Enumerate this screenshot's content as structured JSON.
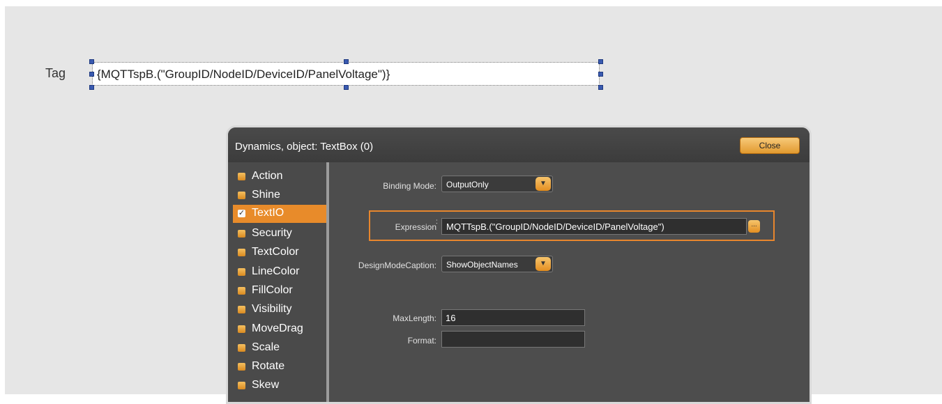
{
  "canvas": {
    "tag_label": "Tag",
    "tag_value": "{MQTTspB.(\"GroupID/NodeID/DeviceID/PanelVoltage\")}"
  },
  "dialog": {
    "title": "Dynamics, object: TextBox (0)",
    "close_label": "Close",
    "sidebar": [
      {
        "label": "Action",
        "selected": false
      },
      {
        "label": "Shine",
        "selected": false
      },
      {
        "label": "TextIO",
        "selected": true
      },
      {
        "label": "Security",
        "selected": false
      },
      {
        "label": "TextColor",
        "selected": false
      },
      {
        "label": "LineColor",
        "selected": false
      },
      {
        "label": "FillColor",
        "selected": false
      },
      {
        "label": "Visibility",
        "selected": false
      },
      {
        "label": "MoveDrag",
        "selected": false
      },
      {
        "label": "Scale",
        "selected": false
      },
      {
        "label": "Rotate",
        "selected": false
      },
      {
        "label": "Skew",
        "selected": false
      }
    ],
    "fields": {
      "binding_mode": {
        "label": "Binding Mode:",
        "value": "OutputOnly"
      },
      "expression": {
        "label": "Expression",
        "colon": ":",
        "value": "MQTTspB.(\"GroupID/NodeID/DeviceID/PanelVoltage\")",
        "button": "..."
      },
      "design_mode_caption": {
        "label": "DesignModeCaption:",
        "value": "ShowObjectNames"
      },
      "max_length": {
        "label": "MaxLength:",
        "value": "16"
      },
      "format": {
        "label": "Format:",
        "value": ""
      }
    }
  },
  "colors": {
    "accent": "#e88b2a",
    "dialog_bg": "#4a4a4a",
    "canvas_bg": "#e6e6e6"
  }
}
